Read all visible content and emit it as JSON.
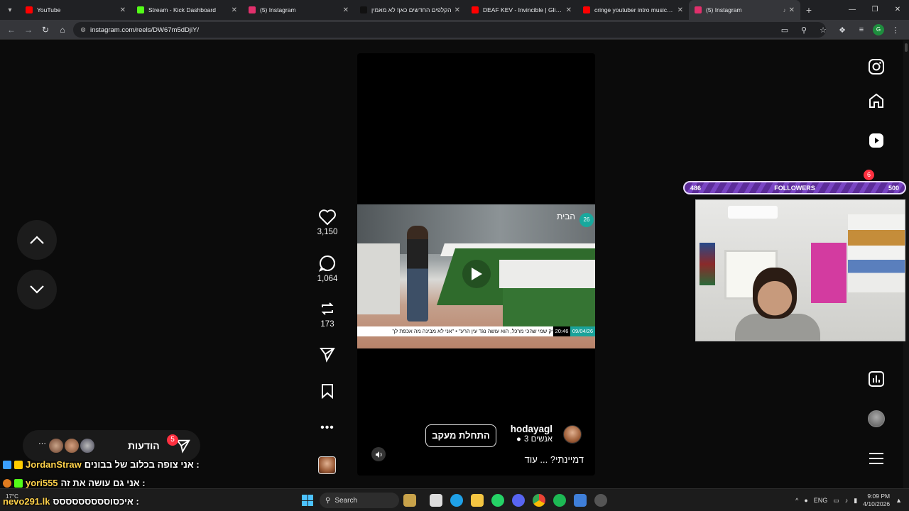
{
  "browser": {
    "tabs": [
      {
        "title": "YouTube",
        "color": "#ff0000",
        "active": false
      },
      {
        "title": "Stream - Kick Dashboard",
        "color": "#53fc18",
        "active": false
      },
      {
        "title": "(5) Instagram",
        "color": "#e1306c",
        "active": false
      },
      {
        "title": "הקלפים החדשים כאן! לא מאמין",
        "color": "#111111",
        "active": false
      },
      {
        "title": "DEAF KEV - Invincible | Glitch H",
        "color": "#ff0000",
        "active": false
      },
      {
        "title": "cringe youtuber intro music - Y",
        "color": "#ff0000",
        "active": false
      },
      {
        "title": "(5) Instagram",
        "color": "#e1306c",
        "active": true
      }
    ],
    "url": "instagram.com/reels/DW67m5dDjiY/",
    "profile_initial": "G"
  },
  "reel": {
    "username": "hodayagl",
    "follower_text": "3 אנשים",
    "follow_label": "התחלת מעקב",
    "caption": "דמיינתי? ... עוד",
    "video_ticker": "זה מצחיק שמי שהכי מרכל, הוא עושה נגד עין הרע\" • \"אני לא מבינה מה אכפת לך",
    "video_time": "20:46",
    "video_date": "09/04/26",
    "video_logo": "הבית",
    "video_badge": "26"
  },
  "actions": {
    "likes": "3,150",
    "comments": "1,064",
    "reposts": "173"
  },
  "sidebar": {
    "notification_count": "6"
  },
  "stream_overlay": {
    "followers_current": "486",
    "followers_label": "FOLLOWERS",
    "followers_goal": "500",
    "followers_progress": 0.972
  },
  "notifications_pill": {
    "label": "הודעות",
    "count": "5"
  },
  "chat": [
    {
      "name": "JordanStraw",
      "message": "אני צופה בכלוב של בבונים :"
    },
    {
      "name": "yori555",
      "message": "אני גם עושה את זה :"
    },
    {
      "name": "nevo291.lk",
      "message": "איכסוססססססססס :"
    }
  ],
  "taskbar": {
    "weather_temp": "17°C",
    "search_placeholder": "Search",
    "lang": "ENG",
    "time": "9:09 PM",
    "date": "4/10/2026"
  }
}
